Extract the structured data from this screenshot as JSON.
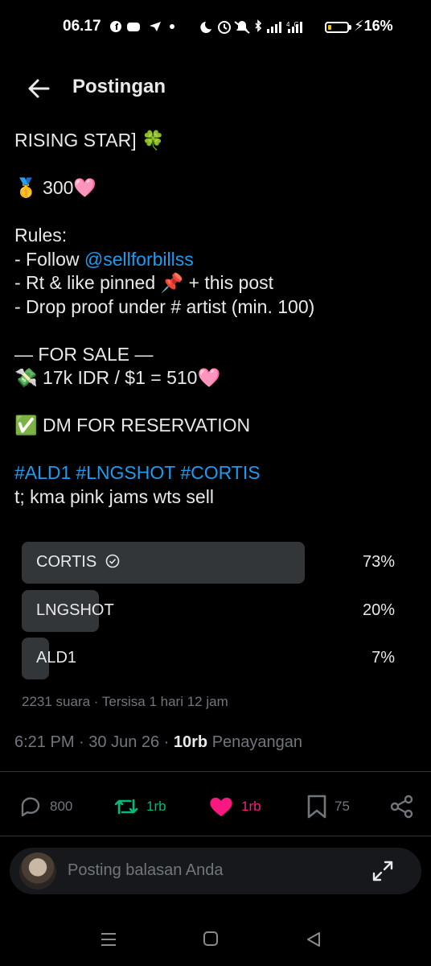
{
  "status_bar": {
    "time": "06.17",
    "battery_percent": "16%",
    "battery_level": 0.16
  },
  "header": {
    "title": "Postingan"
  },
  "post": {
    "lines": {
      "l1": "RISING STAR] 🍀",
      "l2": "🥇 300🩷",
      "l3": "Rules:",
      "l4_prefix": "- Follow ",
      "l4_mention": "@sellforbillss",
      "l5": "- Rt & like pinned 📌 + this post",
      "l6": "- Drop proof under # artist (min. 100)",
      "l7": "— FOR SALE —",
      "l8": "💸 17k IDR / $1 = 510🩷",
      "l9": "✅ DM FOR RESERVATION",
      "l11": "t; kma pink jams wts sell"
    },
    "hashtags": [
      "#ALD1",
      "#LNGSHOT",
      "#CORTIS"
    ]
  },
  "poll": {
    "options": [
      {
        "label": "CORTIS",
        "percent": "73%",
        "value": 73,
        "winner": true
      },
      {
        "label": "LNGSHOT",
        "percent": "20%",
        "value": 20,
        "winner": false
      },
      {
        "label": "ALD1",
        "percent": "7%",
        "value": 7,
        "winner": false
      }
    ],
    "votes": "2231 suara",
    "remaining": "Tersisa 1 hari 12 jam"
  },
  "meta": {
    "time": "6:21 PM",
    "date": "30 Jun 26",
    "views_count": "10rb",
    "views_label": "Penayangan"
  },
  "actions": {
    "reply_count": "800",
    "repost_count": "1rb",
    "like_count": "1rb",
    "bookmark_count": "75"
  },
  "reply_bar": {
    "placeholder": "Posting balasan Anda"
  },
  "colors": {
    "background": "#000000",
    "text": "#e7e9ea",
    "muted": "#71767b",
    "link": "#1d9bf0",
    "repost": "#00ba7c",
    "like": "#f91880",
    "poll_bar": "#333639"
  }
}
